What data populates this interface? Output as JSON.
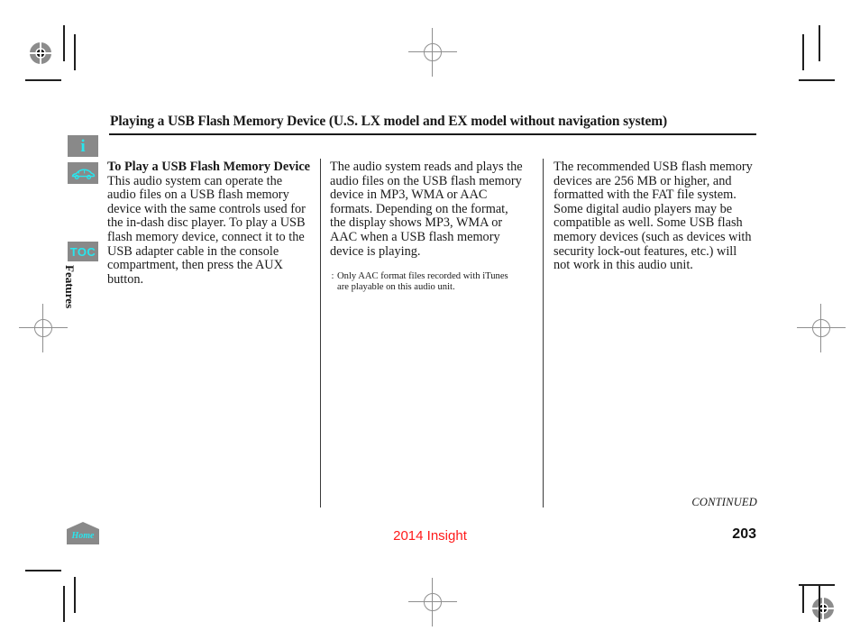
{
  "document": {
    "title": "Playing a USB Flash Memory Device (U.S. LX model and EX model without navigation system)",
    "model_line": "2014 Insight",
    "page_number": "203",
    "continued_label": "CONTINUED"
  },
  "rail": {
    "info_icon_label": "i",
    "car_icon_label": "car-silhouette",
    "toc_label": "TOC",
    "section_label": "Features",
    "home_label": "Home"
  },
  "columns": {
    "column1": {
      "subheading": "To Play a USB Flash Memory Device",
      "body": "This audio system can operate the audio files on a USB flash memory device with the same controls used for the in-dash disc player. To play a USB flash memory device, connect it to the USB adapter cable in the console compartment, then press the AUX button."
    },
    "column2": {
      "body": "The audio system reads and plays the audio files on the USB flash memory device in MP3, WMA or AAC   formats. Depending on the format, the display shows MP3, WMA or AAC when a USB flash memory device is playing.",
      "note_marker": ":",
      "note": "Only AAC format files recorded with iTunes are playable on this audio unit."
    },
    "column3": {
      "body": "The recommended USB flash memory devices are 256 MB or higher, and formatted with the FAT file system. Some digital audio players may be compatible as well. Some USB flash memory devices (such as devices with security lock-out features, etc.) will not work in this audio unit."
    }
  },
  "colors": {
    "icon_cyan": "#28e6ee",
    "icon_gray": "#898989",
    "model_red": "#ff1a1a",
    "text_black": "#1a1a1a"
  }
}
